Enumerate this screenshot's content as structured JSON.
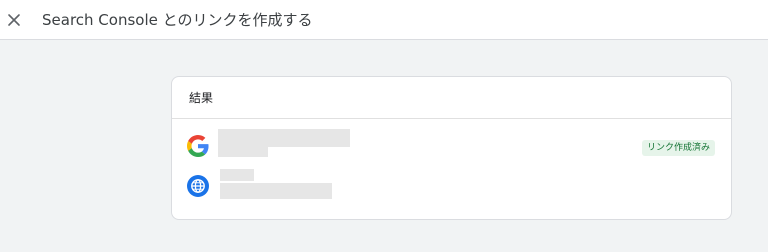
{
  "header": {
    "title": "Search Console とのリンクを作成する",
    "close_icon": "close-icon"
  },
  "card": {
    "heading": "結果",
    "rows": [
      {
        "icon": "google-g-icon",
        "status": "リンク作成済み"
      },
      {
        "icon": "globe-icon"
      }
    ]
  },
  "colors": {
    "background": "#f1f3f4",
    "status_bg": "#e6f4ea",
    "status_text": "#137333",
    "globe_blue": "#1a73e8"
  }
}
